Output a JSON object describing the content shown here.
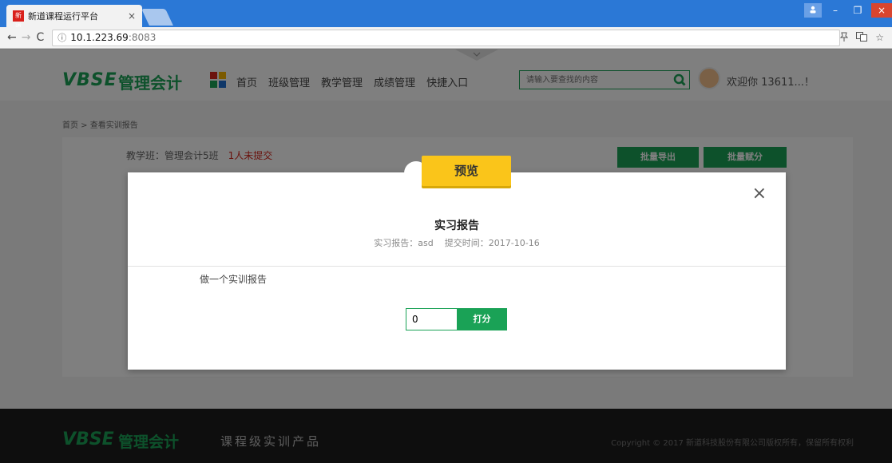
{
  "browser": {
    "tab_title": "新道课程运行平台",
    "tab_close": "×",
    "favicon_text": "新道",
    "url_host": "10.1.223.69",
    "url_port": ":8083",
    "win_min": "–",
    "win_restore": "❐",
    "win_close": "×",
    "back": "←",
    "forward": "→",
    "reload": "C",
    "info": "ⓘ",
    "star": "☆"
  },
  "header": {
    "logo": "VBSE",
    "logo_sub": "管理会计",
    "nav": [
      "首页",
      "班级管理",
      "教学管理",
      "成绩管理",
      "快捷入口"
    ],
    "search_placeholder": "请输入要查找的内容",
    "welcome": "欢迎你 13611...！"
  },
  "breadcrumb": "首页 > 查看实训报告",
  "class_panel": {
    "class_label": "教学班：管理会计5班",
    "unsubmitted": "1人未提交",
    "export_button": "批量导出",
    "grade_button": "批量赋分"
  },
  "modal": {
    "preview_label": "预览",
    "close": "×",
    "title": "实习报告",
    "meta_report": "实习报告：asd",
    "meta_time": "提交时间：2017-10-16",
    "body": "做一个实训报告",
    "score_value": "0",
    "score_button": "打分"
  },
  "footer": {
    "logo": "VBSE",
    "logo_sub": "管理会计",
    "slogan": "课程级实训产品",
    "copyright": "Copyright © 2017 新道科技股份有限公司版权所有，保留所有权利"
  },
  "colors": {
    "brand_green": "#1aa256",
    "preview_yellow": "#fac51a",
    "alert_red": "#d4251b",
    "chrome_blue": "#2b78d6"
  }
}
